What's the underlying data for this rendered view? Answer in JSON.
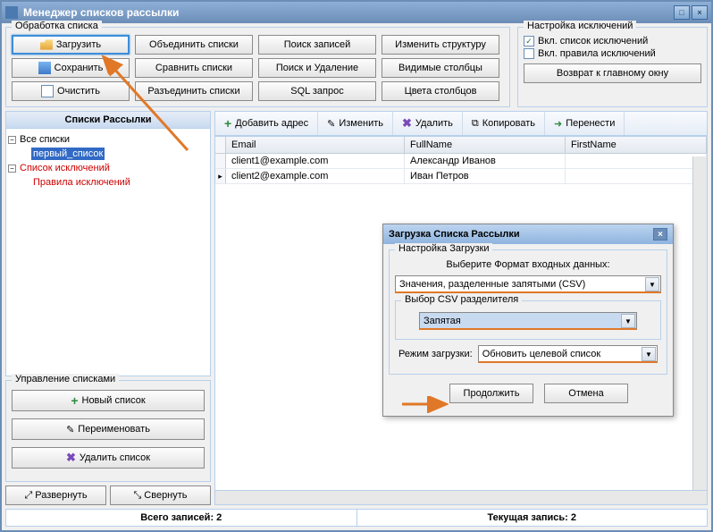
{
  "window": {
    "title": "Менеджер списков рассылки"
  },
  "processing": {
    "legend": "Обработка списка",
    "cols": [
      [
        {
          "label": "Загрузить",
          "icon": "folder"
        },
        {
          "label": "Сохранить",
          "icon": "disk"
        },
        {
          "label": "Очистить",
          "icon": "file"
        }
      ],
      [
        {
          "label": "Объединить списки"
        },
        {
          "label": "Сравнить списки"
        },
        {
          "label": "Разъединить списки"
        }
      ],
      [
        {
          "label": "Поиск записей"
        },
        {
          "label": "Поиск и Удаление"
        },
        {
          "label": "SQL запрос"
        }
      ],
      [
        {
          "label": "Изменить структуру"
        },
        {
          "label": "Видимые столбцы"
        },
        {
          "label": "Цвета столбцов"
        }
      ]
    ]
  },
  "exclusions": {
    "legend": "Настройка исключений",
    "opt1": {
      "label": "Вкл. список исключений",
      "checked": true
    },
    "opt2": {
      "label": "Вкл. правила исключений",
      "checked": false
    },
    "return": "Возврат к главному окну"
  },
  "tree": {
    "title": "Списки Рассылки",
    "all": "Все списки",
    "first": "первый_список",
    "ex_list": "Список исключений",
    "ex_rules": "Правила исключений"
  },
  "manage": {
    "legend": "Управление списками",
    "new": "Новый список",
    "rename": "Переименовать",
    "delete": "Удалить список",
    "expand": "Развернуть",
    "collapse": "Свернуть"
  },
  "toolbar": {
    "add": "Добавить адрес",
    "edit": "Изменить",
    "delete": "Удалить",
    "copy": "Копировать",
    "move": "Перенести"
  },
  "table": {
    "cols": [
      "",
      "Email",
      "FullName",
      "FirstName"
    ],
    "rows": [
      {
        "email": "client1@example.com",
        "fullname": "Александр Иванов",
        "firstname": ""
      },
      {
        "email": "client2@example.com",
        "fullname": "Иван Петров",
        "firstname": ""
      }
    ]
  },
  "status": {
    "total": "Всего записей: 2",
    "current": "Текущая запись: 2"
  },
  "dialog": {
    "title": "Загрузка Списка Рассылки",
    "group": "Настройка Загрузки",
    "format_label": "Выберите Формат входных данных:",
    "format_value": "Значения, разделенные запятыми (CSV)",
    "delim_group": "Выбор CSV разделителя",
    "delim_value": "Запятая",
    "mode_label": "Режим загрузки:",
    "mode_value": "Обновить целевой список",
    "ok": "Продолжить",
    "cancel": "Отмена"
  }
}
